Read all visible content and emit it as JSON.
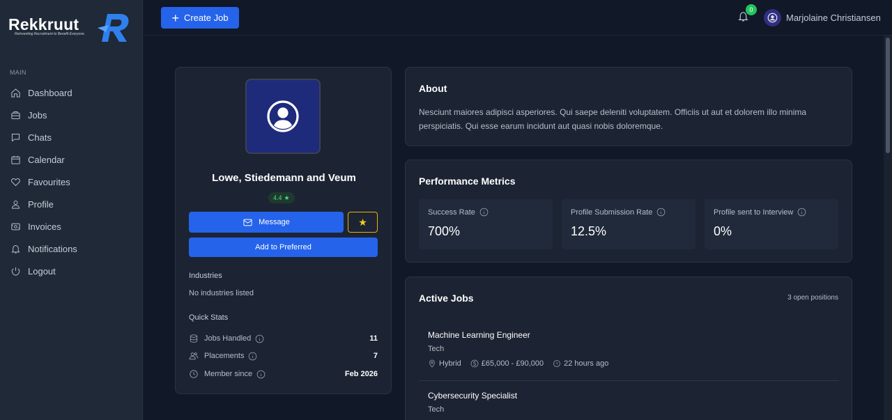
{
  "brand": {
    "name": "Rekkruut",
    "tagline": "Reinventing Recruitment to Benefit Everyone."
  },
  "sidebar": {
    "section": "MAIN",
    "items": [
      {
        "label": "Dashboard",
        "icon": "home-icon"
      },
      {
        "label": "Jobs",
        "icon": "briefcase-icon"
      },
      {
        "label": "Chats",
        "icon": "chat-icon"
      },
      {
        "label": "Calendar",
        "icon": "calendar-icon"
      },
      {
        "label": "Favourites",
        "icon": "heart-icon"
      },
      {
        "label": "Profile",
        "icon": "user-icon"
      },
      {
        "label": "Invoices",
        "icon": "invoice-icon"
      },
      {
        "label": "Notifications",
        "icon": "bell-icon"
      },
      {
        "label": "Logout",
        "icon": "logout-icon"
      }
    ]
  },
  "topbar": {
    "create_label": "Create Job",
    "notification_count": "0",
    "user_name": "Marjolaine Christiansen"
  },
  "profile": {
    "company": "Lowe, Stiedemann and Veum",
    "rating": "4.4",
    "message_label": "Message",
    "preferred_label": "Add to Preferred",
    "industries_label": "Industries",
    "industries_value": "No industries listed",
    "quick_stats_label": "Quick Stats",
    "stats": [
      {
        "label": "Jobs Handled",
        "value": "11"
      },
      {
        "label": "Placements",
        "value": "7"
      },
      {
        "label": "Member since",
        "value": "Feb 2026"
      }
    ]
  },
  "about": {
    "title": "About",
    "text": "Nesciunt maiores adipisci asperiores. Qui saepe deleniti voluptatem. Officiis ut aut et dolorem illo minima perspiciatis. Qui esse earum incidunt aut quasi nobis doloremque."
  },
  "performance": {
    "title": "Performance Metrics",
    "metrics": [
      {
        "label": "Success Rate",
        "value": "700%"
      },
      {
        "label": "Profile Submission Rate",
        "value": "12.5%"
      },
      {
        "label": "Profile sent to Interview",
        "value": "0%"
      }
    ]
  },
  "jobs": {
    "title": "Active Jobs",
    "count": "3 open positions",
    "items": [
      {
        "title": "Machine Learning Engineer",
        "category": "Tech",
        "mode": "Hybrid",
        "salary": "£65,000 - £90,000",
        "posted": "22 hours ago"
      },
      {
        "title": "Cybersecurity Specialist",
        "category": "Tech"
      }
    ]
  },
  "colors": {
    "accent": "#2563eb",
    "background": "#111827",
    "card": "#1c2433",
    "sidebar": "#1f2937",
    "success": "#22c55e",
    "star": "#facc15"
  }
}
